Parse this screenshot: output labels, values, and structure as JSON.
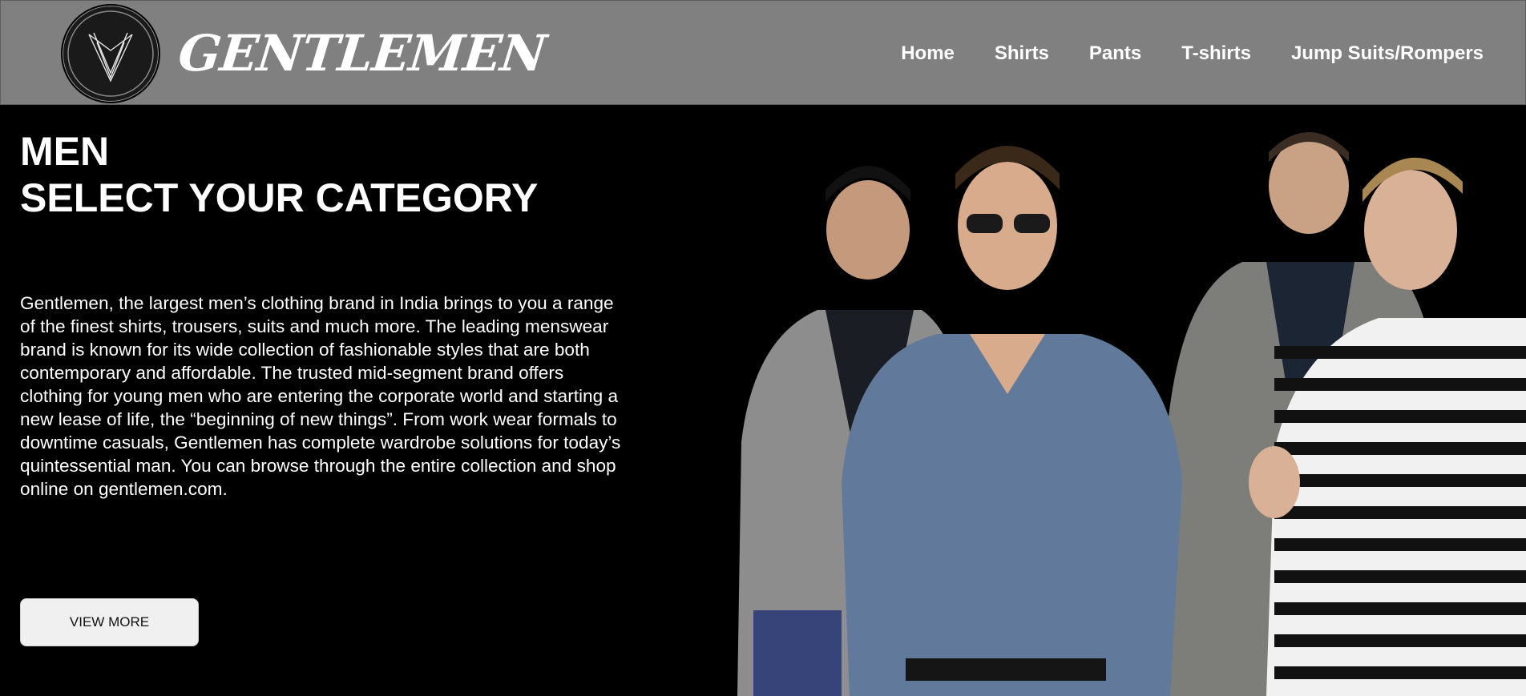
{
  "brand": {
    "name": "GENTLEMEN",
    "logo_icon": "v-monogram-logo-icon"
  },
  "nav": [
    "Home",
    "Shirts",
    "Pants",
    "T-shirts",
    "Jump Suits/Rompers"
  ],
  "hero": {
    "line1": "MEN",
    "line2": "SELECT YOUR CATEGORY",
    "description": "Gentlemen, the largest men’s clothing brand in India brings to you a range of the finest shirts, trousers, suits and much more. The leading menswear brand is known for its wide collection of fashionable styles that are both contemporary and affordable. The trusted mid-segment brand offers clothing for young men who are entering the corporate world and starting a new lease of life, the “beginning of new things”. From work wear formals to downtime casuals, Gentlemen has complete wardrobe solutions for today’s quintessential man. You can browse through the entire collection and shop online on gentlemen.com.",
    "button_label": "VIEW MORE"
  },
  "colors": {
    "header_bg": "#808080",
    "page_bg": "#000000",
    "text": "#ffffff",
    "button_bg": "#f0f0f0"
  }
}
